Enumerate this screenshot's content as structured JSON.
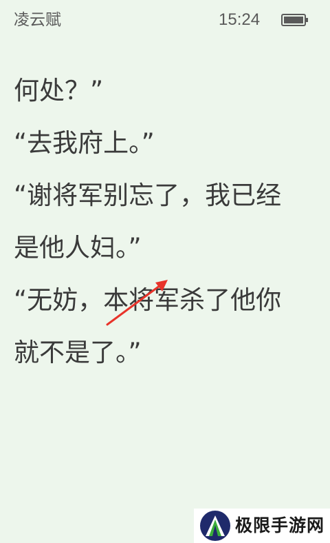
{
  "status_bar": {
    "book_title": "凌云赋",
    "time": "15:24",
    "battery_icon": "battery-icon"
  },
  "reader": {
    "lines": [
      "何处？”",
      "“去我府上。”",
      "“谢将军别忘了，我已经",
      "是他人妇。”",
      "“无妨，本将军杀了他你",
      "就不是了。”"
    ]
  },
  "annotation": {
    "arrow_icon": "red-arrow-icon",
    "color": "#e8332a"
  },
  "watermark": {
    "text": "极限手游网",
    "logo_icon": "mountain-logo-icon"
  },
  "colors": {
    "page_background": "#edf6ec",
    "text": "#3a3a3a"
  }
}
